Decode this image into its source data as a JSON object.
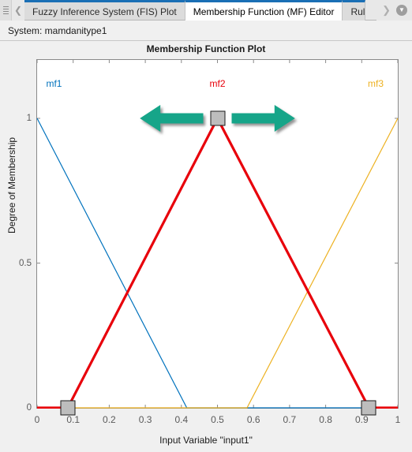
{
  "window": {
    "grip_icon": "grip-dots-icon",
    "prev_tab_icon": "chevron-left-icon",
    "next_tab_icon": "chevron-right-icon",
    "tab_list_icon": "chevron-down-circle-icon"
  },
  "tabs": [
    {
      "label": "Fuzzy Inference System (FIS) Plot",
      "active": false
    },
    {
      "label": "Membership Function (MF) Editor",
      "active": true
    },
    {
      "label": "Rul",
      "active": false
    }
  ],
  "system": {
    "label": "System: mamdanitype1"
  },
  "chart_data": {
    "type": "line",
    "title": "Membership Function Plot",
    "xlabel": "Input Variable \"input1\"",
    "ylabel": "Degree of Membership",
    "xlim": [
      0,
      1
    ],
    "ylim": [
      0,
      1
    ],
    "xticks": [
      "0",
      "0.1",
      "0.2",
      "0.3",
      "0.4",
      "0.5",
      "0.6",
      "0.7",
      "0.8",
      "0.9",
      "1"
    ],
    "xtick_values": [
      0,
      0.1,
      0.2,
      0.3,
      0.4,
      0.5,
      0.6,
      0.7,
      0.8,
      0.9,
      1
    ],
    "yticks": [
      "0",
      "0.5",
      "1"
    ],
    "ytick_values": [
      0,
      0.5,
      1
    ],
    "grid": false,
    "legend_position": "in-plot-top",
    "series": [
      {
        "name": "mf1",
        "color": "#0072BD",
        "selected": false,
        "label_x": 0.012,
        "points": [
          [
            0,
            1
          ],
          [
            0.415,
            0
          ],
          [
            1,
            0
          ]
        ]
      },
      {
        "name": "mf2",
        "color": "#E8000B",
        "selected": true,
        "label_x": 0.5,
        "points": [
          [
            0,
            0
          ],
          [
            0.085,
            0
          ],
          [
            0.5,
            1
          ],
          [
            0.92,
            0
          ],
          [
            1,
            0
          ]
        ]
      },
      {
        "name": "mf3",
        "color": "#EDB120",
        "selected": false,
        "label_x": 0.965,
        "points": [
          [
            0,
            0
          ],
          [
            0.582,
            0
          ],
          [
            1,
            1
          ]
        ]
      }
    ],
    "handles": [
      {
        "name": "left-base-handle",
        "x": 0.085,
        "y": 0
      },
      {
        "name": "peak-handle",
        "x": 0.5,
        "y": 1
      },
      {
        "name": "right-base-handle",
        "x": 0.92,
        "y": 0
      }
    ],
    "annotations": [
      {
        "name": "drag-left-arrow",
        "color": "#17A589",
        "direction": "left",
        "from_x": 0.5,
        "to_x": 0.285,
        "y": 1
      },
      {
        "name": "drag-right-arrow",
        "color": "#17A589",
        "direction": "right",
        "from_x": 0.5,
        "to_x": 0.715,
        "y": 1
      }
    ]
  }
}
